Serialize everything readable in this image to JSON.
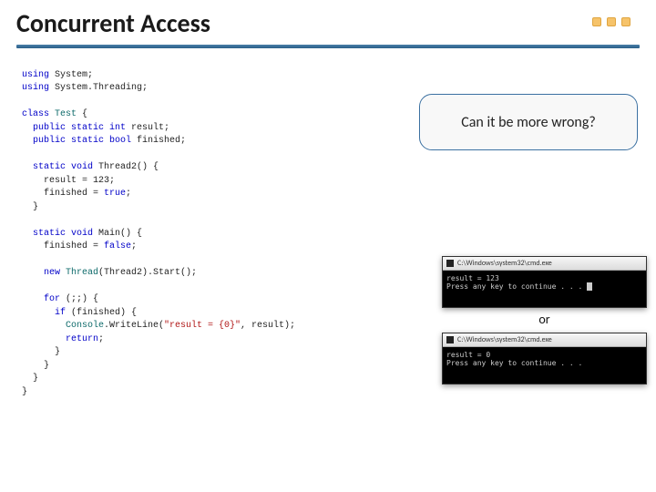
{
  "title": "Concurrent Access",
  "callout": "Can it be more wrong?",
  "code": {
    "l1a": "using",
    "l1b": " System;",
    "l2a": "using",
    "l2b": " System.Threading;",
    "l3a": "class ",
    "l3b": "Test",
    "l3c": " {",
    "l4a": "  public static int",
    "l4b": " result;",
    "l5a": "  public static bool",
    "l5b": " finished;",
    "l6a": "  static void",
    "l6b": " Thread2() {",
    "l7": "    result = 123;",
    "l8a": "    finished = ",
    "l8b": "true",
    "l8c": ";",
    "l9": "  }",
    "l10a": "  static void",
    "l10b": " Main() {",
    "l11a": "    finished = ",
    "l11b": "false",
    "l11c": ";",
    "l12a": "    new ",
    "l12b": "Thread",
    "l12c": "(Thread2).Start();",
    "l13a": "    for",
    "l13b": " (;;) {",
    "l14a": "      if",
    "l14b": " (finished) {",
    "l15a": "        Console",
    "l15b": ".WriteLine(",
    "l15c": "\"result = {0}\"",
    "l15d": ", result);",
    "l16a": "        return",
    "l16b": ";",
    "l17": "      }",
    "l18": "    }",
    "l19": "  }",
    "l20": "}"
  },
  "console1": {
    "title": "C:\\Windows\\system32\\cmd.exe",
    "line1": "result = 123",
    "line2": "Press any key to continue . . ."
  },
  "or_label": "or",
  "console2": {
    "title": "C:\\Windows\\system32\\cmd.exe",
    "line1": "result = 0",
    "line2": "Press any key to continue . . ."
  }
}
